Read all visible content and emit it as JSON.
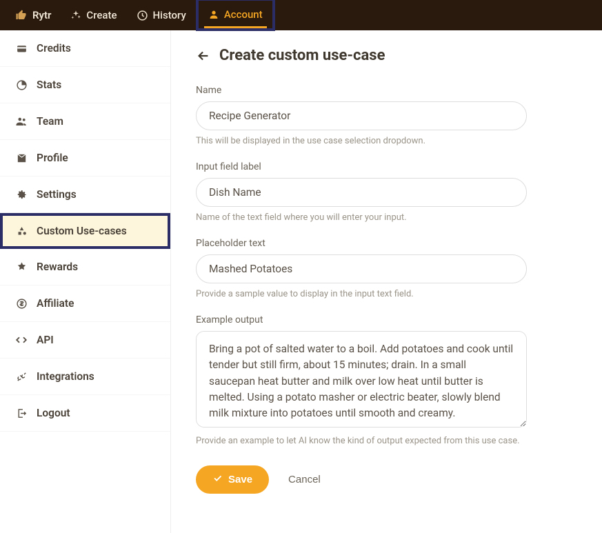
{
  "topbar": {
    "brand": "Rytr",
    "items": [
      {
        "label": "Create",
        "icon": "sparkle"
      },
      {
        "label": "History",
        "icon": "history"
      },
      {
        "label": "Account",
        "icon": "person",
        "active": true,
        "highlighted": true
      }
    ]
  },
  "sidebar": {
    "items": [
      {
        "label": "Credits",
        "icon": "credits"
      },
      {
        "label": "Stats",
        "icon": "stats"
      },
      {
        "label": "Team",
        "icon": "team"
      },
      {
        "label": "Profile",
        "icon": "profile"
      },
      {
        "label": "Settings",
        "icon": "settings"
      },
      {
        "label": "Custom Use-cases",
        "icon": "shapes",
        "active": true,
        "highlighted": true
      },
      {
        "label": "Rewards",
        "icon": "rewards"
      },
      {
        "label": "Affiliate",
        "icon": "affiliate"
      },
      {
        "label": "API",
        "icon": "api"
      },
      {
        "label": "Integrations",
        "icon": "integrations"
      },
      {
        "label": "Logout",
        "icon": "logout"
      }
    ]
  },
  "page": {
    "title": "Create custom use-case",
    "fields": {
      "name": {
        "label": "Name",
        "value": "Recipe Generator",
        "hint": "This will be displayed in the use case selection dropdown."
      },
      "input_label": {
        "label": "Input field label",
        "value": "Dish Name",
        "hint": "Name of the text field where you will enter your input."
      },
      "placeholder": {
        "label": "Placeholder text",
        "value": "Mashed Potatoes",
        "hint": "Provide a sample value to display in the input text field."
      },
      "example": {
        "label": "Example output",
        "value": "Bring a pot of salted water to a boil. Add potatoes and cook until tender but still firm, about 15 minutes; drain. In a small saucepan heat butter and milk over low heat until butter is melted. Using a potato masher or electric beater, slowly blend milk mixture into potatoes until smooth and creamy.",
        "hint": "Provide an example to let AI know the kind of output expected from this use case."
      }
    },
    "actions": {
      "save": "Save",
      "cancel": "Cancel"
    }
  }
}
